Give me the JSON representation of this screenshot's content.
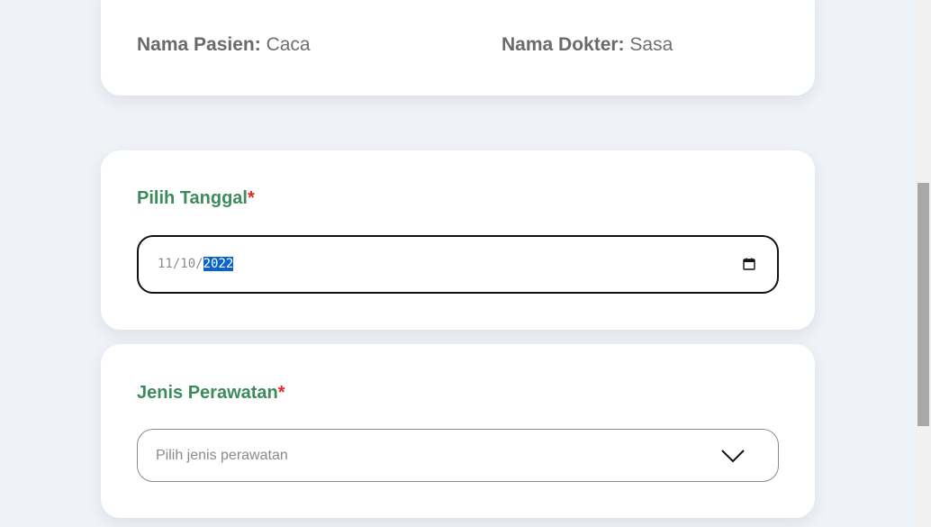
{
  "patient_info": {
    "patient_label": "Nama Pasien:",
    "patient_value": "Caca",
    "doctor_label": "Nama Dokter:",
    "doctor_value": "Sasa"
  },
  "date_section": {
    "label": "Pilih Tanggal",
    "required_mark": "*",
    "date_month": "11",
    "date_day": "10",
    "date_year": "2022",
    "separator": "/",
    "icon": "calendar-icon"
  },
  "care_section": {
    "label": "Jenis Perawatan",
    "required_mark": "*",
    "select_placeholder": "Pilih jenis perawatan",
    "icon": "chevron-down-icon"
  },
  "colors": {
    "label_green": "#3d8b5a",
    "required_red": "#e5252a",
    "selection_blue": "#0a64c9",
    "page_background": "#eff2f7"
  }
}
